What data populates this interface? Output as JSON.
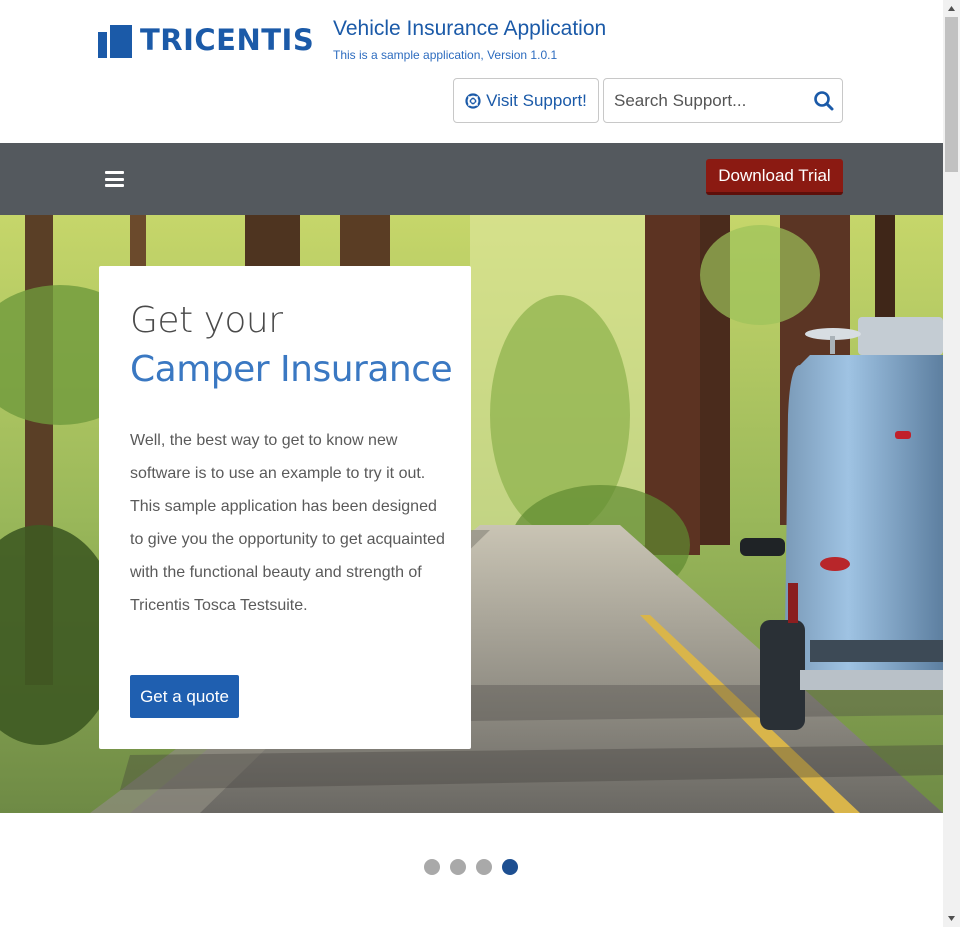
{
  "header": {
    "logo_text": "TRICENTIS",
    "app_title": "Vehicle Insurance Application",
    "app_subtitle": "This is a sample application, Version 1.0.1",
    "support_button_label": "Visit Support!",
    "search_placeholder": "Search Support...",
    "brand_color": "#1b5aa8"
  },
  "nav": {
    "menu_icon": "hamburger-icon",
    "download_label": "Download Trial",
    "download_color": "#8b1a12",
    "background": "#54595e"
  },
  "hero": {
    "heading_line1": "Get your",
    "heading_line2": "Camper Insurance",
    "body": "Well, the best way to get to know new software is to use an example to try it out. This sample application has been designed to give you the opportunity to get acquainted with the functional beauty and strength of Tricentis Tosca Testsuite.",
    "cta_label": "Get a quote",
    "cta_color": "#1f5fb0"
  },
  "carousel": {
    "slide_count": 4,
    "active_slide": 4
  }
}
